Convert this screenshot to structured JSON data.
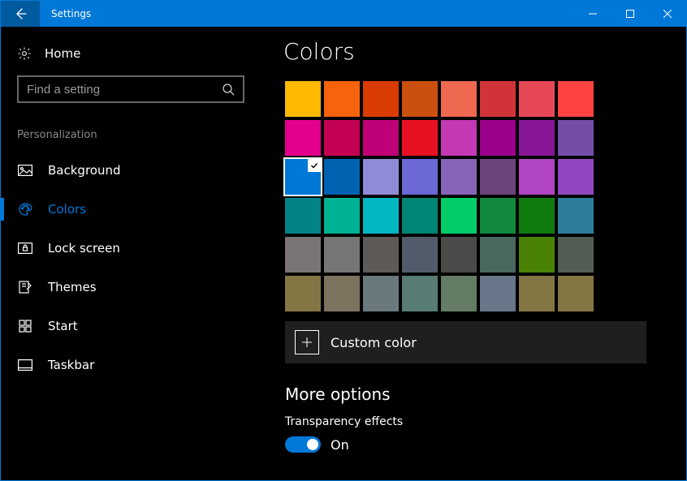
{
  "titlebar": {
    "title": "Settings"
  },
  "sidebar": {
    "home_label": "Home",
    "search_placeholder": "Find a setting",
    "section_label": "Personalization",
    "items": [
      {
        "label": "Background",
        "icon": "image-icon"
      },
      {
        "label": "Colors",
        "icon": "palette-icon"
      },
      {
        "label": "Lock screen",
        "icon": "lock-screen-icon"
      },
      {
        "label": "Themes",
        "icon": "themes-icon"
      },
      {
        "label": "Start",
        "icon": "start-icon"
      },
      {
        "label": "Taskbar",
        "icon": "taskbar-icon"
      }
    ],
    "selected_index": 1
  },
  "main": {
    "page_title": "Colors",
    "swatches": [
      "#ffb900",
      "#f7630c",
      "#da3b01",
      "#ca5010",
      "#ef6950",
      "#d13438",
      "#e74856",
      "#ff4343",
      "#e3008c",
      "#c30052",
      "#bf0077",
      "#e81123",
      "#c239b3",
      "#9a0089",
      "#881798",
      "#744da9",
      "#0078d7",
      "#0063b1",
      "#8e8cd8",
      "#6b69d6",
      "#8764b8",
      "#6b447b",
      "#b146c2",
      "#9146c2",
      "#038387",
      "#00b294",
      "#00b7c3",
      "#018574",
      "#00cc6a",
      "#10893e",
      "#107c10",
      "#2d7d9a",
      "#7a7574",
      "#767676",
      "#5d5a58",
      "#515c6b",
      "#4c4a48",
      "#486860",
      "#498205",
      "#525e54",
      "#847545",
      "#7e735f",
      "#69797e",
      "#567c73",
      "#647c64",
      "#68768a",
      "#847545",
      "#847545"
    ],
    "selected_swatch_index": 16,
    "custom_color_label": "Custom color",
    "more_options_heading": "More options",
    "transparency_label": "Transparency effects",
    "transparency_value": "On",
    "transparency_on": true
  },
  "accent_color": "#0078d7"
}
